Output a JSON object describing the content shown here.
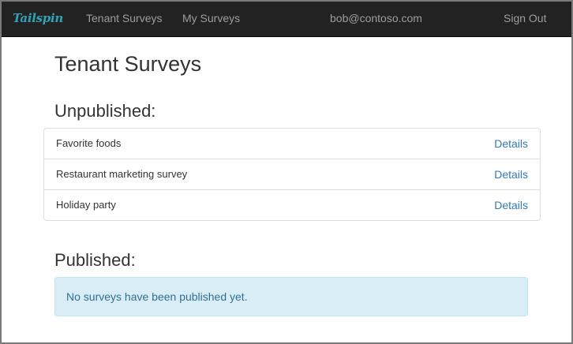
{
  "navbar": {
    "brand": "Tailspin",
    "links": [
      "Tenant Surveys",
      "My Surveys"
    ],
    "user": "bob@contoso.com",
    "sign_out": "Sign Out"
  },
  "main": {
    "title": "Tenant Surveys",
    "unpublished_heading": "Unpublished:",
    "unpublished": [
      {
        "name": "Favorite foods",
        "link": "Details"
      },
      {
        "name": "Restaurant marketing survey",
        "link": "Details"
      },
      {
        "name": "Holiday party",
        "link": "Details"
      }
    ],
    "published_heading": "Published:",
    "published_empty": "No surveys have been published yet."
  },
  "colors": {
    "navbar_bg": "#222222",
    "nav_text": "#9d9d9d",
    "brand": "#2fa4b8",
    "link": "#337ab7",
    "alert_bg": "#d9edf7",
    "alert_text": "#31708f"
  }
}
